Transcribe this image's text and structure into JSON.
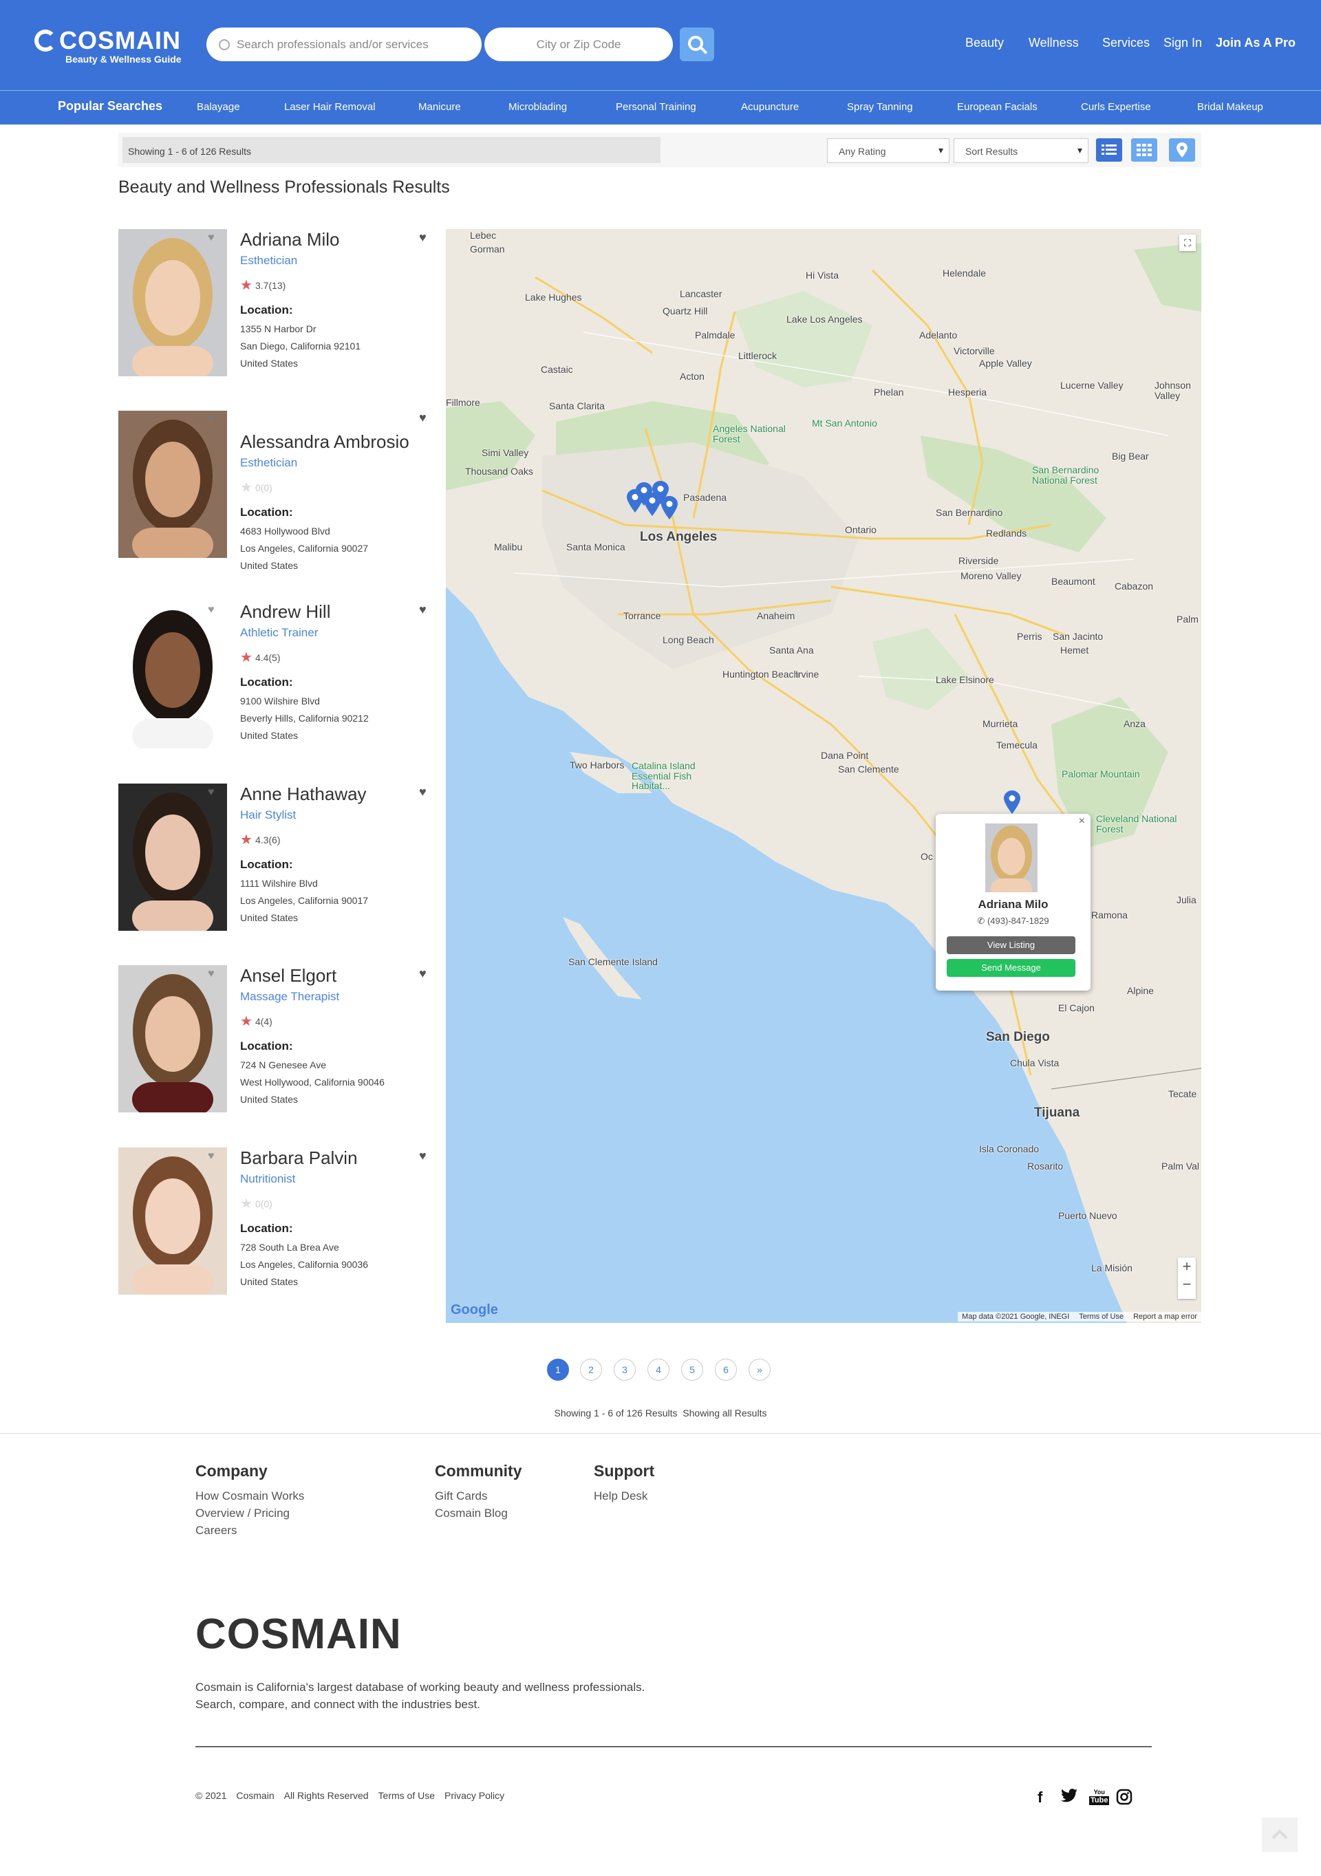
{
  "brand": {
    "name": "COSMAIN",
    "tagline": "Beauty & Wellness Guide"
  },
  "search": {
    "service_placeholder": "Search professionals and/or services",
    "location_placeholder": "City or Zip Code"
  },
  "nav": {
    "beauty": "Beauty",
    "wellness": "Wellness",
    "services": "Services",
    "sign_in": "Sign In",
    "join": "Join As A Pro"
  },
  "popular": {
    "label": "Popular Searches",
    "items": [
      "Balayage",
      "Laser Hair Removal",
      "Manicure",
      "Microblading",
      "Personal Training",
      "Acupuncture",
      "Spray Tanning",
      "European Facials",
      "Curls Expertise",
      "Bridal Makeup"
    ]
  },
  "filters": {
    "showing": "Showing 1 - 6 of 126 Results",
    "rating": "Any Rating",
    "sort": "Sort Results"
  },
  "page_title": "Beauty and Wellness Professionals Results",
  "results": [
    {
      "name": "Adriana Milo",
      "profession": "Esthetician",
      "rating": "3.7(13)",
      "rated": true,
      "location_label": "Location:",
      "street": "1355 N Harbor Dr",
      "city": "San Diego, California 92101",
      "country": "United States"
    },
    {
      "name": "Alessandra Ambrosio",
      "profession": "Esthetician",
      "rating": "0(0)",
      "rated": false,
      "location_label": "Location:",
      "street": "4683 Hollywood Blvd",
      "city": "Los Angeles, California 90027",
      "country": "United States"
    },
    {
      "name": "Andrew Hill",
      "profession": "Athletic Trainer",
      "rating": "4.4(5)",
      "rated": true,
      "location_label": "Location:",
      "street": "9100 Wilshire Blvd",
      "city": "Beverly Hills, California 90212",
      "country": "United States"
    },
    {
      "name": "Anne Hathaway",
      "profession": "Hair Stylist",
      "rating": "4.3(6)",
      "rated": true,
      "location_label": "Location:",
      "street": "1111 Wilshire Blvd",
      "city": "Los Angeles, California 90017",
      "country": "United States"
    },
    {
      "name": "Ansel Elgort",
      "profession": "Massage Therapist",
      "rating": "4(4)",
      "rated": true,
      "location_label": "Location:",
      "street": "724 N Genesee Ave",
      "city": "West Hollywood, California 90046",
      "country": "United States"
    },
    {
      "name": "Barbara Palvin",
      "profession": "Nutritionist",
      "rating": "0(0)",
      "rated": false,
      "location_label": "Location:",
      "street": "728 South La Brea Ave",
      "city": "Los Angeles, California 90036",
      "country": "United States"
    }
  ],
  "map": {
    "popup": {
      "name": "Adriana Milo",
      "phone": "(493)-847-1829",
      "view": "View Listing",
      "message": "Send Message",
      "close": "×"
    },
    "labels": [
      "Lebec",
      "Gorman",
      "Lake Hughes",
      "Lancaster",
      "Quartz Hill",
      "Hi Vista",
      "Helendale",
      "Palmdale",
      "Lake Los Angeles",
      "Littlerock",
      "Adelanto",
      "Victorville",
      "Apple Valley",
      "Hesperia",
      "Castaic",
      "Acton",
      "Phelan",
      "Lucerne Valley",
      "Johnson Valley",
      "Fillmore",
      "Santa Clarita",
      "Angeles National Forest",
      "Mt San Antonio",
      "Simi Valley",
      "Thousand Oaks",
      "Pasadena",
      "Big Bear",
      "San Bernardino National Forest",
      "San Bernardino",
      "Ontario",
      "Redlands",
      "Malibu",
      "Santa Monica",
      "Los Angeles",
      "Riverside",
      "Moreno Valley",
      "Beaumont",
      "Cabazon",
      "Torrance",
      "Anaheim",
      "Long Beach",
      "Santa Ana",
      "Perris",
      "San Jacinto",
      "Hemet",
      "Huntington Beach",
      "Irvine",
      "Lake Elsinore",
      "Murrieta",
      "Anza",
      "Temecula",
      "Dana Point",
      "San Clemente",
      "Two Harbors",
      "Catalina Island Essential Fish Habitat...",
      "Palomar Mountain",
      "Cleveland National Forest",
      "Ramona",
      "San Clemente Island",
      "Alpine",
      "El Cajon",
      "San Diego",
      "Chula Vista",
      "Tijuana",
      "Isla Coronado",
      "Rosarito",
      "Puerto Nuevo",
      "La Misión",
      "Palm",
      "Julia",
      "Tecate",
      "Oc",
      "Palm Val"
    ],
    "attribution": "Map data ©2021 Google, INEGI",
    "terms": "Terms of Use",
    "report": "Report a map error",
    "google": "Google",
    "zoom_in": "+",
    "zoom_out": "−"
  },
  "pagination": {
    "pages": [
      "1",
      "2",
      "3",
      "4",
      "5",
      "6"
    ],
    "next": "»",
    "summary": "Showing 1 - 6 of 126 Results  Showing all Results"
  },
  "footer": {
    "company": {
      "title": "Company",
      "links": [
        "How Cosmain Works",
        "Overview / Pricing",
        "Careers"
      ]
    },
    "community": {
      "title": "Community",
      "links": [
        "Gift Cards",
        "Cosmain Blog"
      ]
    },
    "support": {
      "title": "Support",
      "links": [
        "Help Desk"
      ]
    },
    "logo": "COSMAIN",
    "desc1": "Cosmain is California's largest database of working beauty and wellness professionals.",
    "desc2": "Search, compare, and connect with the industries best.",
    "legal": [
      "© 2021",
      "Cosmain",
      "All Rights Reserved",
      "Terms of Use",
      "Privacy Policy"
    ]
  },
  "colors": {
    "primary": "#3a72d8",
    "link": "#4a86e8",
    "star": "#e05a5a",
    "message": "#22c35e"
  }
}
